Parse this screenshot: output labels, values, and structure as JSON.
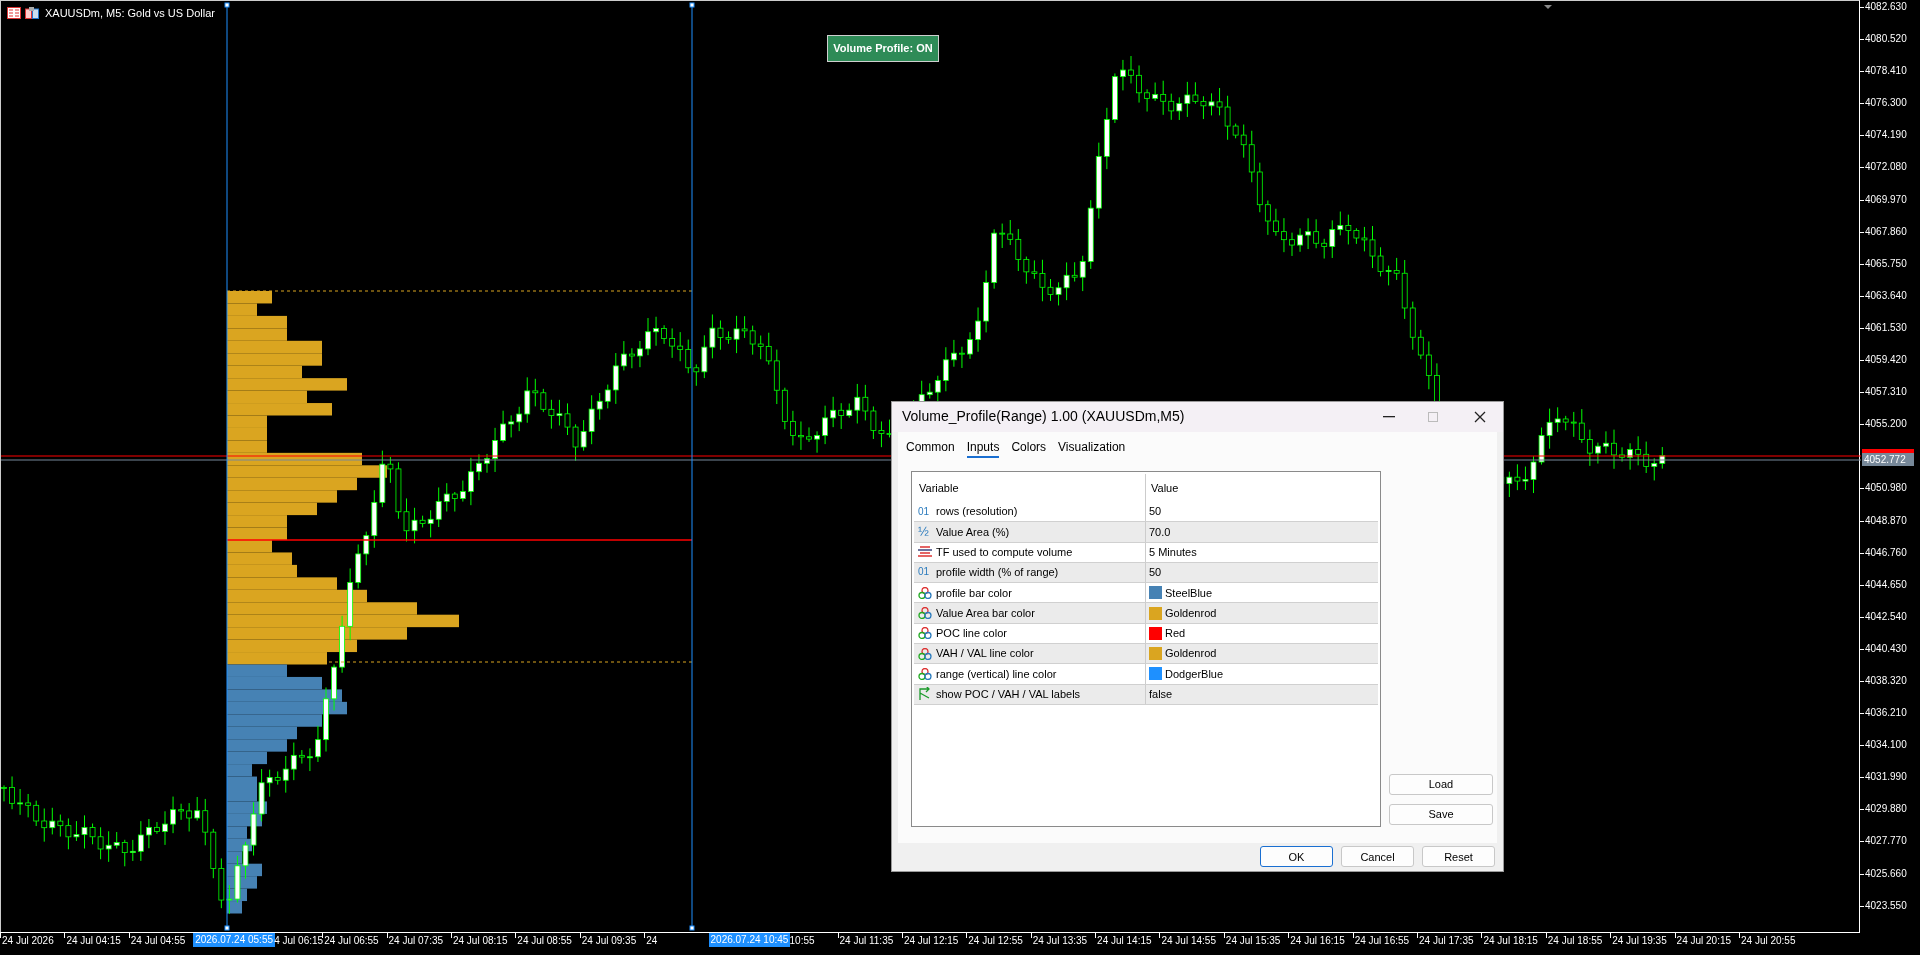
{
  "chart": {
    "title": "XAUUSDm, M5:  Gold vs US Dollar",
    "toggle_button": "Volume Profile: ON",
    "price_axis": {
      "upper_labels": [
        "4082.630",
        "4080.520",
        "4078.410",
        "4076.300",
        "4074.190",
        "4072.080",
        "4069.970",
        "4067.860",
        "4065.750",
        "4063.640",
        "4061.530",
        "4059.420",
        "4057.310",
        "4055.200"
      ],
      "current_price": "4052.772",
      "lower_labels": [
        "4050.980",
        "4048.870",
        "4046.760",
        "4044.650",
        "4042.540",
        "4040.430",
        "4038.320",
        "4036.210",
        "4034.100",
        "4031.990",
        "4029.880",
        "4027.770",
        "4025.660",
        "4023.550"
      ]
    },
    "time_axis": [
      {
        "label": "24 Jul 2026",
        "kind": "tick"
      },
      {
        "label": "24 Jul 04:15",
        "kind": "tick"
      },
      {
        "label": "24 Jul 04:55",
        "kind": "tick"
      },
      {
        "label": "2026.07.24 05:55",
        "kind": "marker"
      },
      {
        "label": "4 Jul 06:15",
        "kind": "clipped"
      },
      {
        "label": "24 Jul 06:55",
        "kind": "tick"
      },
      {
        "label": "24 Jul 07:35",
        "kind": "tick"
      },
      {
        "label": "24 Jul 08:15",
        "kind": "tick"
      },
      {
        "label": "24 Jul 08:55",
        "kind": "tick"
      },
      {
        "label": "24 Jul 09:35",
        "kind": "tick"
      },
      {
        "label": "24",
        "kind": "tick"
      },
      {
        "label": "2026.07.24 10:45",
        "kind": "marker"
      },
      {
        "label": "10:55",
        "kind": "clipped"
      },
      {
        "label": "24 Jul 11:35",
        "kind": "tick"
      },
      {
        "label": "24 Jul 12:15",
        "kind": "tick"
      },
      {
        "label": "24 Jul 12:55",
        "kind": "tick"
      },
      {
        "label": "24 Jul 13:35",
        "kind": "tick"
      },
      {
        "label": "24 Jul 14:15",
        "kind": "tick"
      },
      {
        "label": "24 Jul 14:55",
        "kind": "tick"
      },
      {
        "label": "24 Jul 15:35",
        "kind": "tick"
      },
      {
        "label": "24 Jul 16:15",
        "kind": "tick"
      },
      {
        "label": "24 Jul 16:55",
        "kind": "tick"
      },
      {
        "label": "24 Jul 17:35",
        "kind": "tick"
      },
      {
        "label": "24 Jul 18:15",
        "kind": "tick"
      },
      {
        "label": "24 Jul 18:55",
        "kind": "tick"
      },
      {
        "label": "24 Jul 19:35",
        "kind": "tick"
      },
      {
        "label": "24 Jul 20:15",
        "kind": "tick"
      },
      {
        "label": "24 Jul 20:55",
        "kind": "tick"
      }
    ]
  },
  "dialog": {
    "title": "Volume_Profile(Range) 1.00 (XAUUSDm,M5)",
    "tabs": [
      {
        "label": "Common",
        "selected": false
      },
      {
        "label": "Inputs",
        "selected": true
      },
      {
        "label": "Colors",
        "selected": false
      },
      {
        "label": "Visualization",
        "selected": false
      }
    ],
    "table": {
      "columns": [
        "Variable",
        "Value"
      ],
      "rows": [
        {
          "kind": "int",
          "icon": "01",
          "variable": "rows (resolution)",
          "value": "50"
        },
        {
          "kind": "fraction",
          "icon": "½",
          "variable": "Value Area (%)",
          "value": "70.0"
        },
        {
          "kind": "enum",
          "variable": "TF used to compute volume",
          "value": "5 Minutes"
        },
        {
          "kind": "int",
          "icon": "01",
          "variable": "profile width (% of range)",
          "value": "50"
        },
        {
          "kind": "color",
          "variable": "profile bar color",
          "value": "SteelBlue",
          "color": "#4682b4"
        },
        {
          "kind": "color",
          "variable": "Value Area bar color",
          "value": "Goldenrod",
          "color": "#daa520"
        },
        {
          "kind": "color",
          "variable": "POC line color",
          "value": "Red",
          "color": "#ff0000"
        },
        {
          "kind": "color",
          "variable": "VAH / VAL line color",
          "value": "Goldenrod",
          "color": "#daa520"
        },
        {
          "kind": "color",
          "variable": "range (vertical) line color",
          "value": "DodgerBlue",
          "color": "#1e90ff"
        },
        {
          "kind": "bool",
          "variable": "show POC / VAH / VAL labels",
          "value": "false"
        }
      ]
    },
    "side_buttons": [
      "Load",
      "Save"
    ],
    "buttons": [
      {
        "label": "OK",
        "default": true
      },
      {
        "label": "Cancel",
        "default": false
      },
      {
        "label": "Reset",
        "default": false
      }
    ]
  }
}
